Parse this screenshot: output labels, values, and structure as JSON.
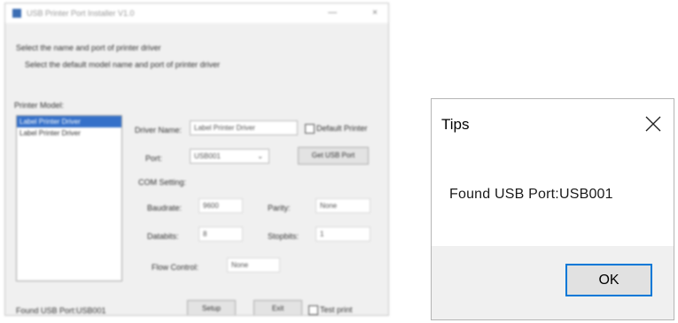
{
  "installer": {
    "title": "USB Printer Port Installer V1.0",
    "window_controls": [
      "—",
      "×"
    ],
    "heading": "Select the name and port of printer driver",
    "subheading": "Select the default model name and port of printer driver",
    "section_label": "Printer Model:",
    "models": [
      "Label Printer Driver",
      "Label Printer Driver"
    ],
    "driver_name_label": "Driver Name:",
    "driver_name_value": "Label Printer Driver",
    "default_printer_label": "Default Printer",
    "port_label": "Port:",
    "port_value": "USB001",
    "get_usb_button": "Get USB Port",
    "com_setting_label": "COM Setting:",
    "baudrate_label": "Baudrate:",
    "baudrate_value": "9600",
    "parity_label": "Parity:",
    "parity_value": "None",
    "databits_label": "Databits:",
    "databits_value": "8",
    "stopbits_label": "Stopbits:",
    "stopbits_value": "1",
    "flow_control_label": "Flow Control:",
    "flow_control_value": "None",
    "footer_text": "Found USB Port:USB001",
    "setup_button": "Setup",
    "exit_button": "Exit",
    "test_print_label": "Test print"
  },
  "tips": {
    "title": "Tips",
    "message": "Found USB Port:USB001",
    "ok_label": "OK"
  },
  "icons": {
    "close": "close-icon",
    "dropdown": "chevron-down-icon"
  },
  "colors": {
    "accent": "#0078d7",
    "selection": "#3570c9",
    "dialog_footer": "#f0f0f0"
  }
}
